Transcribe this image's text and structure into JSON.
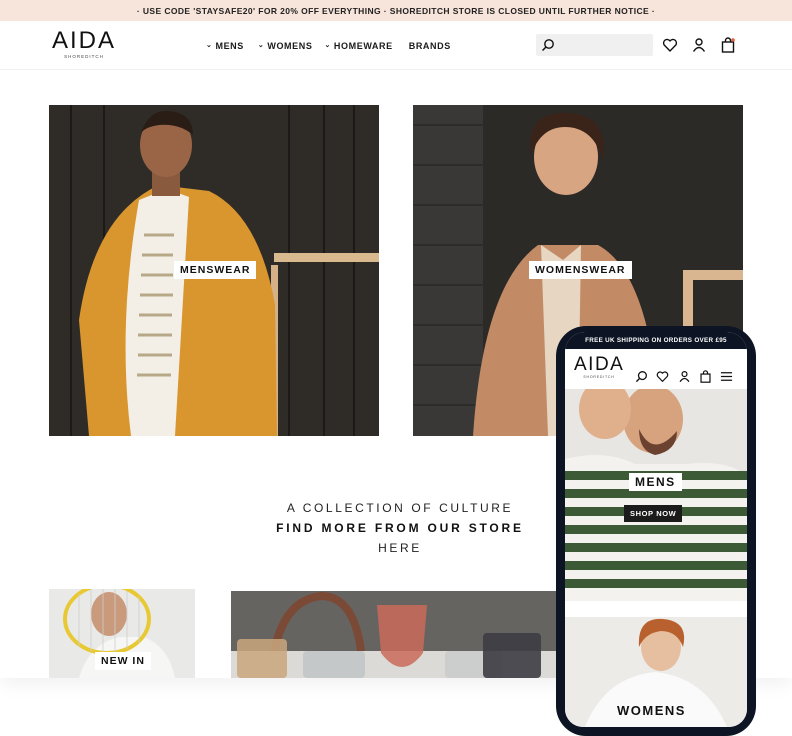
{
  "promo_bar": "· USE CODE 'STAYSAFE20' FOR 20% OFF EVERYTHING · SHOREDITCH STORE IS CLOSED UNTIL FURTHER NOTICE ·",
  "brand": {
    "name": "AIDA",
    "location": "SHOREDITCH"
  },
  "nav": [
    {
      "label": "MENS",
      "has_dropdown": true
    },
    {
      "label": "WOMENS",
      "has_dropdown": true
    },
    {
      "label": "HOMEWARE",
      "has_dropdown": true
    },
    {
      "label": "BRANDS",
      "has_dropdown": false
    }
  ],
  "search": {
    "placeholder": ""
  },
  "header_icons": [
    "search-icon",
    "heart-icon",
    "user-icon",
    "bag-icon"
  ],
  "hero_tiles": [
    {
      "label": "MENSWEAR"
    },
    {
      "label": "WOMENSWEAR"
    }
  ],
  "collection": {
    "line1": "A COLLECTION OF CULTURE",
    "line2": "FIND MORE FROM OUR STORE",
    "line3": "HERE"
  },
  "bottom_tiles": [
    {
      "label": "NEW IN"
    }
  ],
  "mobile": {
    "promo": "FREE UK SHIPPING ON ORDERS OVER £95",
    "brand": {
      "name": "AIDA",
      "location": "SHOREDITCH"
    },
    "mens": {
      "label": "MENS",
      "button": "SHOP NOW"
    },
    "womens": {
      "label": "WOMENS"
    }
  },
  "colors": {
    "promo_bg": "#f7e4da",
    "phone_frame": "#0d1424",
    "search_bg": "#f0f0f0"
  }
}
